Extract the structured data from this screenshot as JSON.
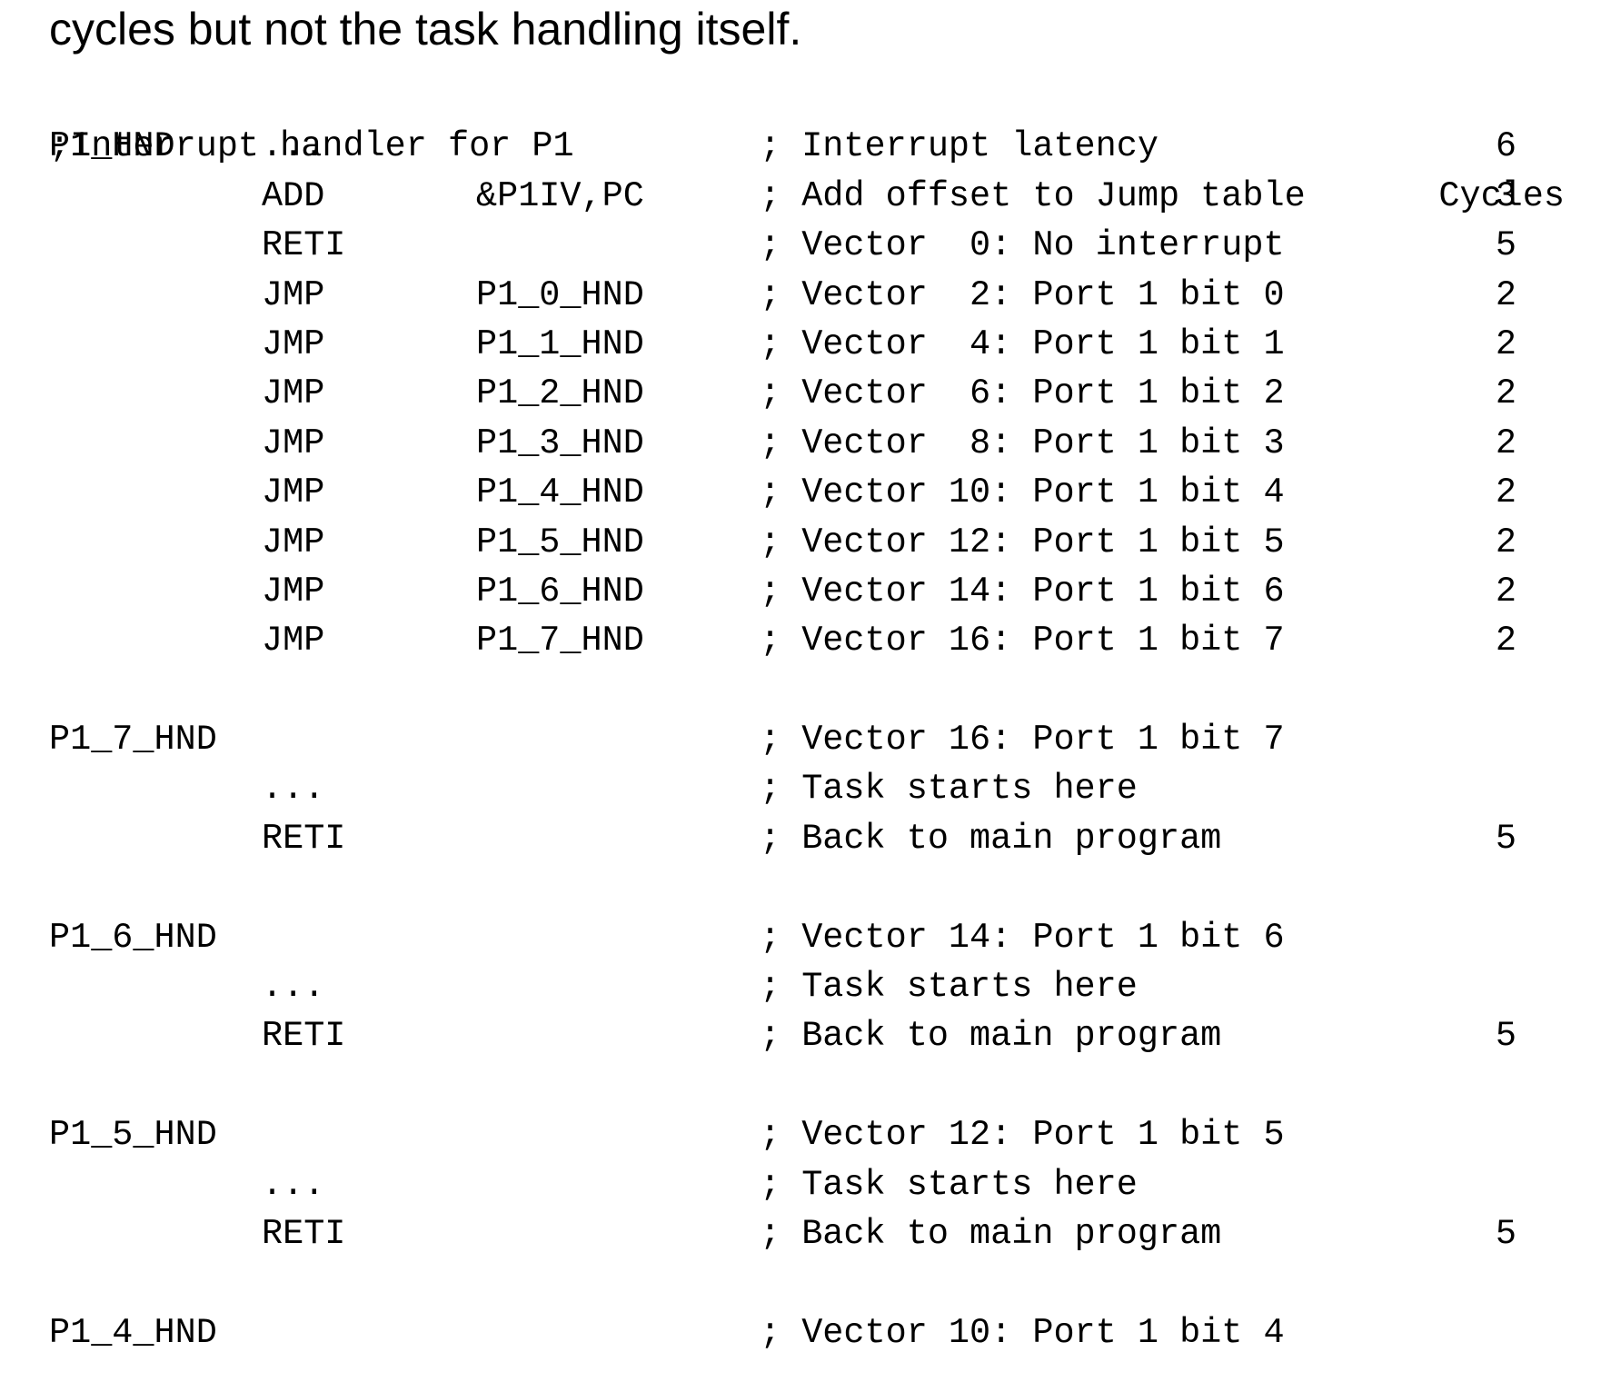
{
  "intro_text": "cycles but not the task handling itself.",
  "listing": {
    "header": {
      "title": ";Interrupt handler for P1",
      "cycles_heading": "Cycles"
    },
    "rows": [
      {
        "label": "P1_HND",
        "op": "...",
        "arg": "",
        "comment": "; Interrupt latency",
        "cycles": "6"
      },
      {
        "label": "",
        "op": "ADD",
        "arg": "&P1IV,PC",
        "comment": "; Add offset to Jump table",
        "cycles": "3"
      },
      {
        "label": "",
        "op": "RETI",
        "arg": "",
        "comment": "; Vector  0: No interrupt",
        "cycles": "5"
      },
      {
        "label": "",
        "op": "JMP",
        "arg": "P1_0_HND",
        "comment": "; Vector  2: Port 1 bit 0",
        "cycles": "2"
      },
      {
        "label": "",
        "op": "JMP",
        "arg": "P1_1_HND",
        "comment": "; Vector  4: Port 1 bit 1",
        "cycles": "2"
      },
      {
        "label": "",
        "op": "JMP",
        "arg": "P1_2_HND",
        "comment": "; Vector  6: Port 1 bit 2",
        "cycles": "2"
      },
      {
        "label": "",
        "op": "JMP",
        "arg": "P1_3_HND",
        "comment": "; Vector  8: Port 1 bit 3",
        "cycles": "2"
      },
      {
        "label": "",
        "op": "JMP",
        "arg": "P1_4_HND",
        "comment": "; Vector 10: Port 1 bit 4",
        "cycles": "2"
      },
      {
        "label": "",
        "op": "JMP",
        "arg": "P1_5_HND",
        "comment": "; Vector 12: Port 1 bit 5",
        "cycles": "2"
      },
      {
        "label": "",
        "op": "JMP",
        "arg": "P1_6_HND",
        "comment": "; Vector 14: Port 1 bit 6",
        "cycles": "2"
      },
      {
        "label": "",
        "op": "JMP",
        "arg": "P1_7_HND",
        "comment": "; Vector 16: Port 1 bit 7",
        "cycles": "2"
      },
      {
        "blank": true
      },
      {
        "label": "P1_7_HND",
        "op": "",
        "arg": "",
        "comment": "; Vector 16: Port 1 bit 7",
        "cycles": ""
      },
      {
        "label": "",
        "op": "...",
        "arg": "",
        "comment": "; Task starts here",
        "cycles": ""
      },
      {
        "label": "",
        "op": "RETI",
        "arg": "",
        "comment": "; Back to main program",
        "cycles": "5"
      },
      {
        "blank": true
      },
      {
        "label": "P1_6_HND",
        "op": "",
        "arg": "",
        "comment": "; Vector 14: Port 1 bit 6",
        "cycles": ""
      },
      {
        "label": "",
        "op": "...",
        "arg": "",
        "comment": "; Task starts here",
        "cycles": ""
      },
      {
        "label": "",
        "op": "RETI",
        "arg": "",
        "comment": "; Back to main program",
        "cycles": "5"
      },
      {
        "blank": true
      },
      {
        "label": "P1_5_HND",
        "op": "",
        "arg": "",
        "comment": "; Vector 12: Port 1 bit 5",
        "cycles": ""
      },
      {
        "label": "",
        "op": "...",
        "arg": "",
        "comment": "; Task starts here",
        "cycles": ""
      },
      {
        "label": "",
        "op": "RETI",
        "arg": "",
        "comment": "; Back to main program",
        "cycles": "5"
      },
      {
        "blank": true
      },
      {
        "label": "P1_4_HND",
        "op": "",
        "arg": "",
        "comment": "; Vector 10: Port 1 bit 4",
        "cycles": ""
      }
    ]
  }
}
